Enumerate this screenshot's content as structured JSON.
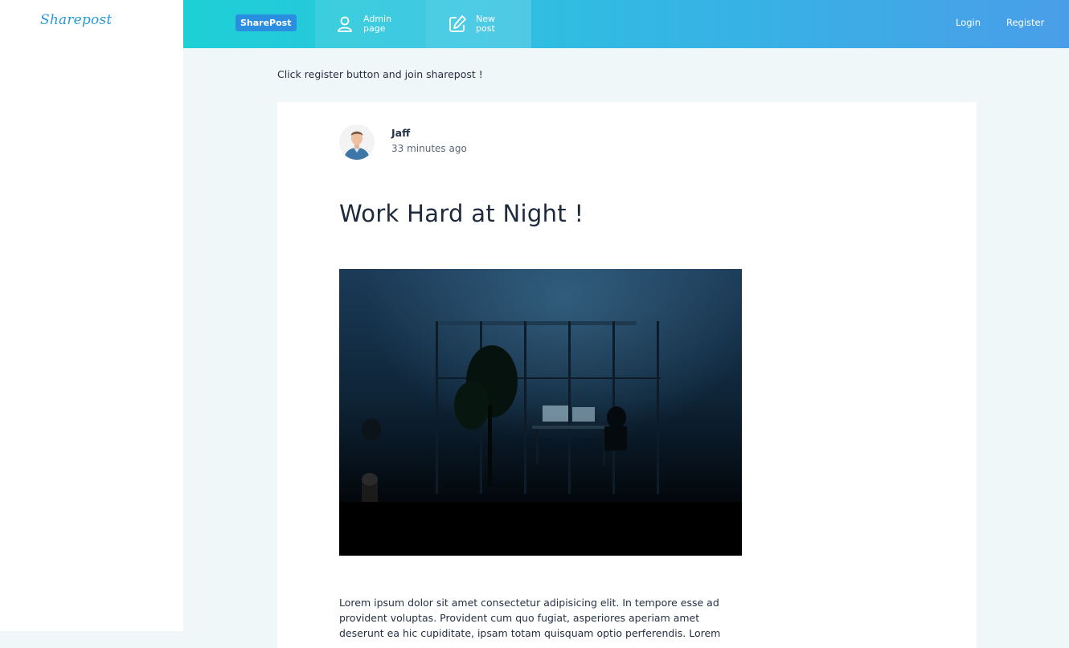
{
  "app": {
    "logo_text": "Sharepost",
    "brand_badge": "SharePost"
  },
  "nav": {
    "admin_label": "Admin page",
    "new_post_label": "New post",
    "login_label": "Login",
    "register_label": "Register",
    "admin_icon": "user-icon",
    "new_post_icon": "edit-icon"
  },
  "notice": "Click register button and join sharepost !",
  "post": {
    "author": "Jaff",
    "time": "33 minutes ago",
    "title": "Work Hard at Night !",
    "body": "Lorem ipsum dolor sit amet consectetur adipisicing elit. In tempore esse ad provident voluptas. Provident cum quo fugiat, asperiores aperiam amet deserunt ea hic cupiditate, ipsam totam quisquam optio perferendis. Lorem"
  },
  "colors": {
    "accent": "#2a8ee0",
    "topbar_start": "#1ed0d6",
    "topbar_end": "#4a9ee8",
    "background": "#f0f7f8"
  }
}
